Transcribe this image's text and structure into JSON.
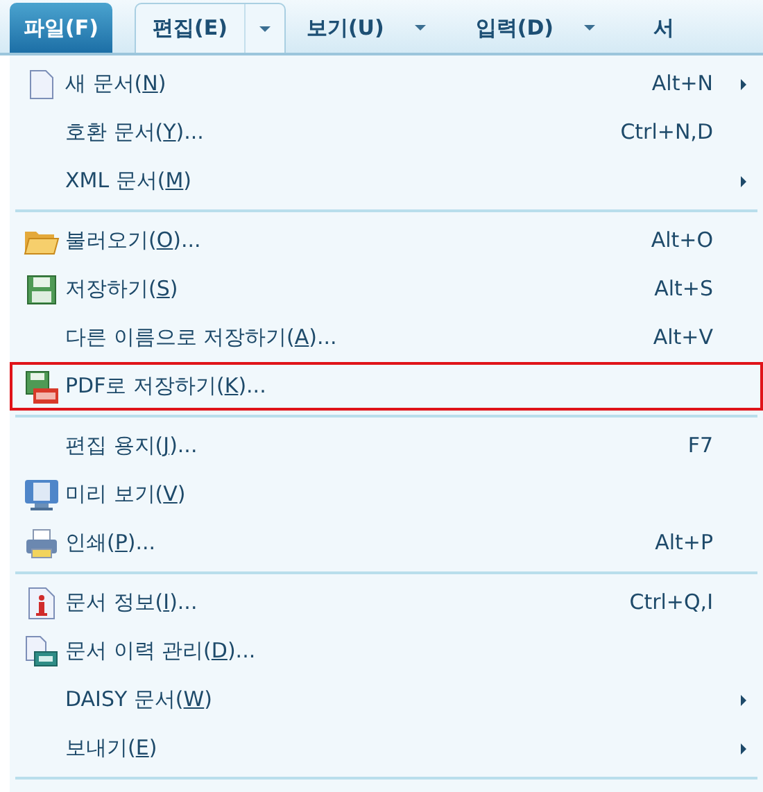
{
  "menu_bar": [
    {
      "label": "파일(F)",
      "selected": true,
      "dropdown": false
    },
    {
      "label": "편집(E)",
      "selected": false,
      "dropdown": true,
      "hovered": true
    },
    {
      "label": "보기(U)",
      "selected": false,
      "dropdown": true,
      "hovered": false
    },
    {
      "label": "입력(D)",
      "selected": false,
      "dropdown": true,
      "hovered": false
    },
    {
      "label": "서",
      "selected": false,
      "dropdown": false,
      "hovered": false
    }
  ],
  "file_menu": {
    "items": [
      {
        "kind": "item",
        "before": "새 문서(",
        "mnemonic": "N",
        "after": ")",
        "shortcut": "Alt+N",
        "submenu": true,
        "highlighted": false
      },
      {
        "kind": "item",
        "before": "호환 문서(",
        "mnemonic": "Y",
        "after": ")...",
        "shortcut": "Ctrl+N,D",
        "submenu": false,
        "highlighted": false
      },
      {
        "kind": "item",
        "before": "XML 문서(",
        "mnemonic": "M",
        "after": ")",
        "submenu": true,
        "highlighted": false
      },
      {
        "kind": "separator"
      },
      {
        "kind": "item",
        "before": "불러오기(",
        "mnemonic": "O",
        "after": ")...",
        "shortcut": "Alt+O",
        "submenu": false,
        "highlighted": false
      },
      {
        "kind": "item",
        "before": "저장하기(",
        "mnemonic": "S",
        "after": ")",
        "shortcut": "Alt+S",
        "submenu": false,
        "highlighted": false
      },
      {
        "kind": "item",
        "before": "다른 이름으로 저장하기(",
        "mnemonic": "A",
        "after": ")...",
        "shortcut": "Alt+V",
        "submenu": false,
        "highlighted": false
      },
      {
        "kind": "item",
        "before": "PDF로 저장하기(",
        "mnemonic": "K",
        "after": ")...",
        "submenu": false,
        "highlighted": true
      },
      {
        "kind": "separator"
      },
      {
        "kind": "item",
        "before": "편집 용지(",
        "mnemonic": "J",
        "after": ")...",
        "shortcut": "F7",
        "submenu": false,
        "highlighted": false
      },
      {
        "kind": "item",
        "before": "미리 보기(",
        "mnemonic": "V",
        "after": ")",
        "submenu": false,
        "highlighted": false
      },
      {
        "kind": "item",
        "before": "인쇄(",
        "mnemonic": "P",
        "after": ")...",
        "shortcut": "Alt+P",
        "submenu": false,
        "highlighted": false
      },
      {
        "kind": "separator"
      },
      {
        "kind": "item",
        "before": "문서 정보(",
        "mnemonic": "I",
        "after": ")...",
        "shortcut": "Ctrl+Q,I",
        "submenu": false,
        "highlighted": false
      },
      {
        "kind": "item",
        "before": "문서 이력 관리(",
        "mnemonic": "D",
        "after": ")...",
        "submenu": false,
        "highlighted": false
      },
      {
        "kind": "item",
        "before": "DAISY 문서(",
        "mnemonic": "W",
        "after": ")",
        "submenu": true,
        "highlighted": false
      },
      {
        "kind": "item",
        "before": "보내기(",
        "mnemonic": "E",
        "after": ")",
        "submenu": true,
        "highlighted": false
      },
      {
        "kind": "separator"
      }
    ]
  }
}
